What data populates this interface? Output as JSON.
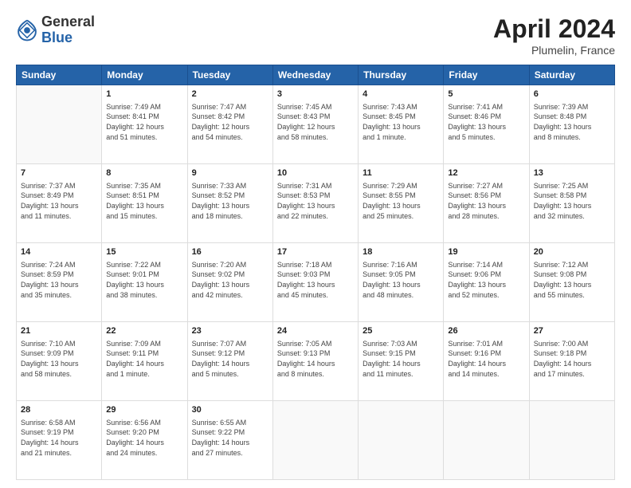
{
  "logo": {
    "general": "General",
    "blue": "Blue"
  },
  "title": {
    "month": "April 2024",
    "location": "Plumelin, France"
  },
  "days_of_week": [
    "Sunday",
    "Monday",
    "Tuesday",
    "Wednesday",
    "Thursday",
    "Friday",
    "Saturday"
  ],
  "weeks": [
    [
      {
        "day": "",
        "info": ""
      },
      {
        "day": "1",
        "info": "Sunrise: 7:49 AM\nSunset: 8:41 PM\nDaylight: 12 hours\nand 51 minutes."
      },
      {
        "day": "2",
        "info": "Sunrise: 7:47 AM\nSunset: 8:42 PM\nDaylight: 12 hours\nand 54 minutes."
      },
      {
        "day": "3",
        "info": "Sunrise: 7:45 AM\nSunset: 8:43 PM\nDaylight: 12 hours\nand 58 minutes."
      },
      {
        "day": "4",
        "info": "Sunrise: 7:43 AM\nSunset: 8:45 PM\nDaylight: 13 hours\nand 1 minute."
      },
      {
        "day": "5",
        "info": "Sunrise: 7:41 AM\nSunset: 8:46 PM\nDaylight: 13 hours\nand 5 minutes."
      },
      {
        "day": "6",
        "info": "Sunrise: 7:39 AM\nSunset: 8:48 PM\nDaylight: 13 hours\nand 8 minutes."
      }
    ],
    [
      {
        "day": "7",
        "info": "Sunrise: 7:37 AM\nSunset: 8:49 PM\nDaylight: 13 hours\nand 11 minutes."
      },
      {
        "day": "8",
        "info": "Sunrise: 7:35 AM\nSunset: 8:51 PM\nDaylight: 13 hours\nand 15 minutes."
      },
      {
        "day": "9",
        "info": "Sunrise: 7:33 AM\nSunset: 8:52 PM\nDaylight: 13 hours\nand 18 minutes."
      },
      {
        "day": "10",
        "info": "Sunrise: 7:31 AM\nSunset: 8:53 PM\nDaylight: 13 hours\nand 22 minutes."
      },
      {
        "day": "11",
        "info": "Sunrise: 7:29 AM\nSunset: 8:55 PM\nDaylight: 13 hours\nand 25 minutes."
      },
      {
        "day": "12",
        "info": "Sunrise: 7:27 AM\nSunset: 8:56 PM\nDaylight: 13 hours\nand 28 minutes."
      },
      {
        "day": "13",
        "info": "Sunrise: 7:25 AM\nSunset: 8:58 PM\nDaylight: 13 hours\nand 32 minutes."
      }
    ],
    [
      {
        "day": "14",
        "info": "Sunrise: 7:24 AM\nSunset: 8:59 PM\nDaylight: 13 hours\nand 35 minutes."
      },
      {
        "day": "15",
        "info": "Sunrise: 7:22 AM\nSunset: 9:01 PM\nDaylight: 13 hours\nand 38 minutes."
      },
      {
        "day": "16",
        "info": "Sunrise: 7:20 AM\nSunset: 9:02 PM\nDaylight: 13 hours\nand 42 minutes."
      },
      {
        "day": "17",
        "info": "Sunrise: 7:18 AM\nSunset: 9:03 PM\nDaylight: 13 hours\nand 45 minutes."
      },
      {
        "day": "18",
        "info": "Sunrise: 7:16 AM\nSunset: 9:05 PM\nDaylight: 13 hours\nand 48 minutes."
      },
      {
        "day": "19",
        "info": "Sunrise: 7:14 AM\nSunset: 9:06 PM\nDaylight: 13 hours\nand 52 minutes."
      },
      {
        "day": "20",
        "info": "Sunrise: 7:12 AM\nSunset: 9:08 PM\nDaylight: 13 hours\nand 55 minutes."
      }
    ],
    [
      {
        "day": "21",
        "info": "Sunrise: 7:10 AM\nSunset: 9:09 PM\nDaylight: 13 hours\nand 58 minutes."
      },
      {
        "day": "22",
        "info": "Sunrise: 7:09 AM\nSunset: 9:11 PM\nDaylight: 14 hours\nand 1 minute."
      },
      {
        "day": "23",
        "info": "Sunrise: 7:07 AM\nSunset: 9:12 PM\nDaylight: 14 hours\nand 5 minutes."
      },
      {
        "day": "24",
        "info": "Sunrise: 7:05 AM\nSunset: 9:13 PM\nDaylight: 14 hours\nand 8 minutes."
      },
      {
        "day": "25",
        "info": "Sunrise: 7:03 AM\nSunset: 9:15 PM\nDaylight: 14 hours\nand 11 minutes."
      },
      {
        "day": "26",
        "info": "Sunrise: 7:01 AM\nSunset: 9:16 PM\nDaylight: 14 hours\nand 14 minutes."
      },
      {
        "day": "27",
        "info": "Sunrise: 7:00 AM\nSunset: 9:18 PM\nDaylight: 14 hours\nand 17 minutes."
      }
    ],
    [
      {
        "day": "28",
        "info": "Sunrise: 6:58 AM\nSunset: 9:19 PM\nDaylight: 14 hours\nand 21 minutes."
      },
      {
        "day": "29",
        "info": "Sunrise: 6:56 AM\nSunset: 9:20 PM\nDaylight: 14 hours\nand 24 minutes."
      },
      {
        "day": "30",
        "info": "Sunrise: 6:55 AM\nSunset: 9:22 PM\nDaylight: 14 hours\nand 27 minutes."
      },
      {
        "day": "",
        "info": ""
      },
      {
        "day": "",
        "info": ""
      },
      {
        "day": "",
        "info": ""
      },
      {
        "day": "",
        "info": ""
      }
    ]
  ]
}
